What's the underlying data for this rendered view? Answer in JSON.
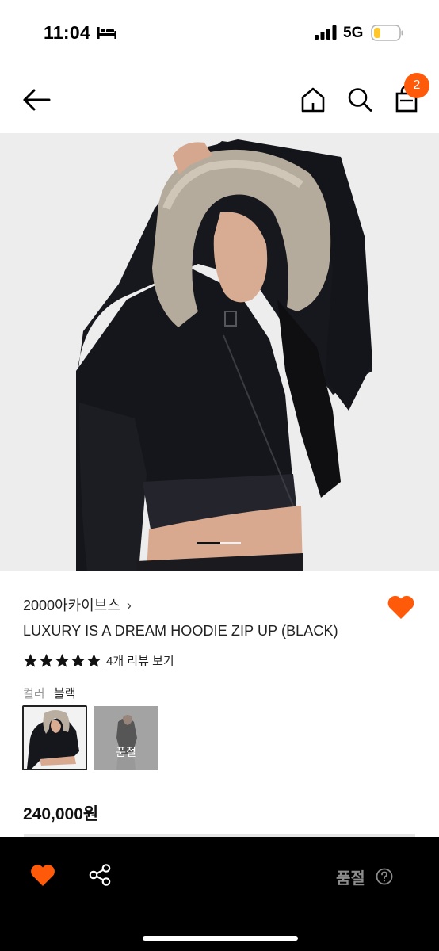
{
  "status_bar": {
    "time": "11:04",
    "network": "5G"
  },
  "nav": {
    "cart_count": "2"
  },
  "hero": {
    "current_slide": 1,
    "accent": "#ff5a0a"
  },
  "product": {
    "brand": "2000아카이브스",
    "brand_chevron": "›",
    "name": "LUXURY IS A DREAM HOODIE ZIP UP (BLACK)",
    "rating": 5,
    "review_link": "4개 리뷰 보기",
    "color_label": "컬러",
    "color_value": "블랙",
    "swatches": [
      {
        "selected": true,
        "sold_out": false
      },
      {
        "selected": false,
        "sold_out": true,
        "label": "품절"
      }
    ],
    "price": "240,000원"
  },
  "bottom_bar": {
    "soldout_label": "품절"
  },
  "icons": {
    "back": "back-arrow-icon",
    "home": "home-icon",
    "search": "search-icon",
    "bag": "shopping-bag-icon",
    "heart": "heart-icon",
    "share": "share-icon",
    "help": "help-circle-icon"
  },
  "colors": {
    "accent": "#ff5a0a",
    "bottom_bar": "#000000",
    "muted": "#8c8c8c"
  }
}
